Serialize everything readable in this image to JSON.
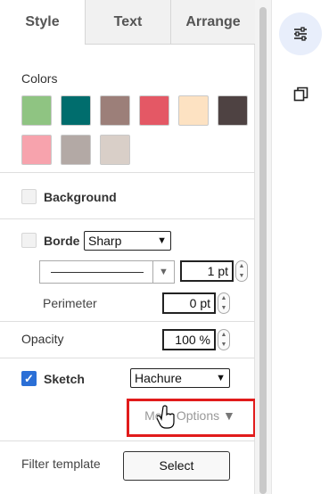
{
  "tabs": {
    "style": "Style",
    "text": "Text",
    "arrange": "Arrange"
  },
  "colors": {
    "label": "Colors",
    "swatches": [
      "#8fc482",
      "#006d6d",
      "#9c7f79",
      "#e45865",
      "#fde2c2",
      "#4e4242",
      "#f7a3ad",
      "#b3a9a5",
      "#d9cfc8"
    ]
  },
  "background": {
    "label": "Background",
    "checked": false
  },
  "border": {
    "label": "Borde",
    "style_value": "Sharp",
    "width_value": "1 pt",
    "checked": false
  },
  "perimeter": {
    "label": "Perimeter",
    "value": "0 pt"
  },
  "opacity": {
    "label": "Opacity",
    "value": "100 %"
  },
  "sketch": {
    "label": "Sketch",
    "checked": true,
    "style_value": "Hachure",
    "more_options": "More Options"
  },
  "filter": {
    "label": "Filter template",
    "button": "Select"
  },
  "sidebar": {
    "format_icon": "sliders-icon",
    "copy_icon": "copy-icon"
  },
  "accent_highlight": "#e11b1b"
}
